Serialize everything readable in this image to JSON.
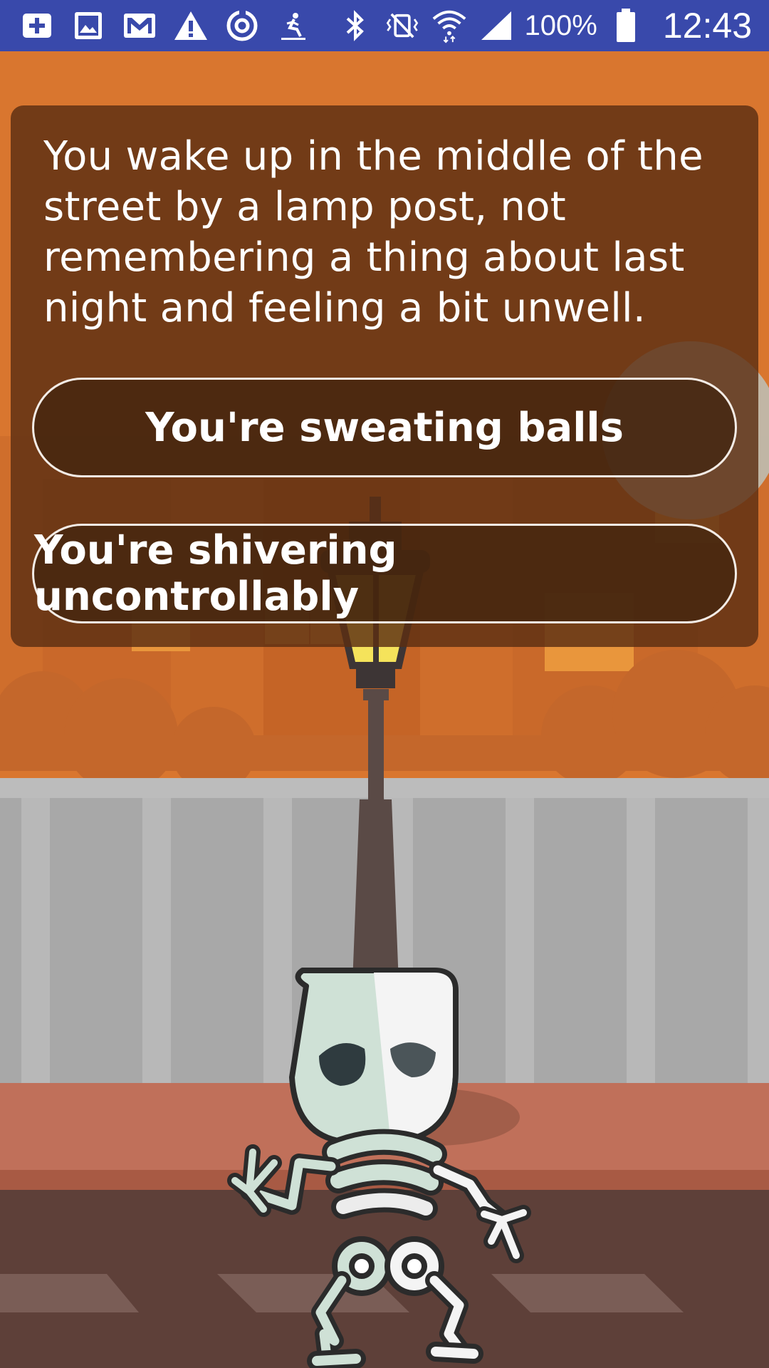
{
  "status_bar": {
    "notification_icons": [
      "add-box-icon",
      "image-icon",
      "gmail-icon",
      "warning-icon",
      "sync-icon",
      "accessibility-icon"
    ],
    "system_icons": [
      "bluetooth-icon",
      "vibrate-icon",
      "wifi-icon",
      "signal-icon",
      "battery-icon"
    ],
    "battery_text": "100%",
    "clock": "12:43",
    "background_color": "#3949ab"
  },
  "story": {
    "text": "You wake up in the middle of the street by a lamp post, not remembering a thing about last night and feeling a bit unwell."
  },
  "choices": [
    {
      "label": "You're sweating balls"
    },
    {
      "label": "You're shivering uncontrollably"
    }
  ],
  "colors": {
    "sky": "#d9762f",
    "wall": "#a9a9a9",
    "sidewalk": "#c0705a",
    "street": "#5e4039",
    "dialog": "#5c2e12"
  }
}
